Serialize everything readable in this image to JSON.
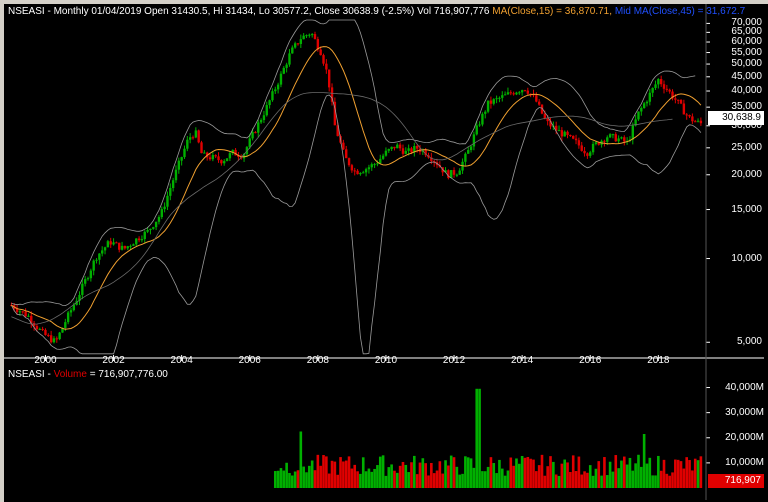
{
  "header": {
    "price_text": "NSEASI - Monthly 01/04/2019 Open 31430.5, Hi 31434, Lo 30577.2, Close 30638.9 (-2.5%) Vol 716,907,776",
    "ma_text": "MA(Close,15) = 36,870.71,",
    "bb_text": "Mid MA(Close,45) = 31,672.7",
    "volume_label": "NSEASI -",
    "volume_word": "Volume",
    "volume_value": "= 716,907,776.00"
  },
  "last_price_label": "30,638.9",
  "last_volume_label": "716,907",
  "colors": {
    "up": "#00b000",
    "down": "#e00000",
    "ma": "#f0a030",
    "bands": "#9a9a9a",
    "background": "#000000"
  },
  "chart_data": [
    {
      "type": "candlestick",
      "title": "NSEASI - Monthly",
      "y_scale": "log",
      "ylim": [
        4500,
        72000
      ],
      "y_ticks": [
        "70,000",
        "65,000",
        "60,000",
        "55,000",
        "50,000",
        "45,000",
        "40,000",
        "35,000",
        "30,000",
        "25,000",
        "20,000",
        "15,000",
        "10,000",
        "5,000"
      ],
      "x_ticks": [
        "2000",
        "2002",
        "2004",
        "2006",
        "2008",
        "2010",
        "2012",
        "2014",
        "2016",
        "2018"
      ],
      "x_range": [
        1998.9,
        2019.4
      ],
      "series": [
        {
          "name": "MA(Close,15)"
        },
        {
          "name": "Mid MA(Close,45)"
        }
      ],
      "close_path": [
        [
          1999.0,
          6800
        ],
        [
          1999.5,
          6200
        ],
        [
          1999.9,
          5400
        ],
        [
          2000.3,
          5000
        ],
        [
          2000.6,
          6000
        ],
        [
          2001.0,
          7500
        ],
        [
          2001.5,
          10200
        ],
        [
          2001.9,
          11500
        ],
        [
          2002.3,
          10800
        ],
        [
          2002.7,
          11800
        ],
        [
          2003.0,
          12500
        ],
        [
          2003.4,
          14500
        ],
        [
          2003.8,
          20000
        ],
        [
          2004.2,
          27000
        ],
        [
          2004.4,
          28500
        ],
        [
          2004.6,
          23500
        ],
        [
          2004.9,
          23000
        ],
        [
          2005.2,
          22500
        ],
        [
          2005.5,
          24000
        ],
        [
          2005.8,
          23500
        ],
        [
          2006.1,
          28000
        ],
        [
          2006.5,
          35000
        ],
        [
          2006.9,
          45000
        ],
        [
          2007.2,
          55000
        ],
        [
          2007.5,
          62000
        ],
        [
          2007.8,
          65000
        ],
        [
          2008.1,
          55000
        ],
        [
          2008.3,
          45000
        ],
        [
          2008.5,
          30000
        ],
        [
          2008.8,
          23000
        ],
        [
          2009.1,
          20500
        ],
        [
          2009.4,
          21000
        ],
        [
          2009.7,
          22000
        ],
        [
          2010.0,
          24000
        ],
        [
          2010.3,
          25500
        ],
        [
          2010.6,
          24000
        ],
        [
          2010.9,
          25000
        ],
        [
          2011.2,
          24000
        ],
        [
          2011.5,
          22000
        ],
        [
          2011.8,
          20000
        ],
        [
          2012.1,
          20500
        ],
        [
          2012.4,
          24000
        ],
        [
          2012.7,
          30000
        ],
        [
          2013.0,
          36000
        ],
        [
          2013.4,
          38000
        ],
        [
          2013.8,
          40000
        ],
        [
          2014.1,
          41000
        ],
        [
          2014.4,
          37000
        ],
        [
          2014.7,
          31000
        ],
        [
          2015.0,
          29000
        ],
        [
          2015.3,
          27500
        ],
        [
          2015.6,
          26000
        ],
        [
          2015.9,
          24000
        ],
        [
          2016.2,
          26000
        ],
        [
          2016.5,
          27500
        ],
        [
          2016.8,
          27000
        ],
        [
          2017.1,
          26000
        ],
        [
          2017.4,
          33000
        ],
        [
          2017.7,
          38000
        ],
        [
          2018.0,
          44000
        ],
        [
          2018.3,
          40000
        ],
        [
          2018.6,
          36000
        ],
        [
          2018.9,
          32000
        ],
        [
          2019.2,
          30639
        ]
      ]
    },
    {
      "type": "bar",
      "title": "NSEASI - Volume",
      "ylim": [
        0,
        43000
      ],
      "y_ticks": [
        "40,000M",
        "30,000M",
        "20,000M",
        "10,000M"
      ],
      "unit": "M",
      "x_range": [
        1998.9,
        2019.4
      ],
      "volume_start": 2006.7,
      "spikes": [
        [
          2007.5,
          22500
        ],
        [
          2012.7,
          39500
        ],
        [
          2017.6,
          21500
        ]
      ],
      "base_volume_m": 9500
    }
  ]
}
